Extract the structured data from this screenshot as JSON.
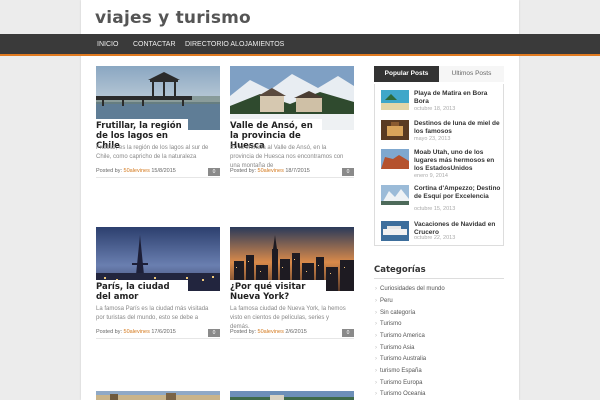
{
  "site": {
    "title": "viajes y turismo"
  },
  "nav": {
    "items": [
      "INICIO",
      "CONTACTAR",
      "DIRECTORIO ALOJAMIENTOS"
    ]
  },
  "posts": [
    {
      "title": "Frutillar, la región de los lagos en Chile",
      "excerpt": "Frutillar, es la región de los lagos al sur de Chile, como capricho de la naturaleza",
      "meta_prefix": "Posted by:",
      "author": "50alevines",
      "date": "15/8/2015",
      "comments": "0"
    },
    {
      "title": "Valle de Ansó, en la provincia de Huesca",
      "excerpt": "En la entrada al Valle de Ansó, en la provincia de Huesca nos encontramos con una montaña de",
      "meta_prefix": "Posted by:",
      "author": "50alevines",
      "date": "18/7/2015",
      "comments": "0"
    },
    {
      "title": "París, la ciudad del amor",
      "excerpt": "La famosa París es la ciudad más visitada por turistas del mundo, esto se debe a",
      "meta_prefix": "Posted by:",
      "author": "50alevines",
      "date": "17/6/2015",
      "comments": "0"
    },
    {
      "title": "¿Por qué visitar Nueva York?",
      "excerpt": "La famosa ciudad de Nueva York, la hemos visto en cientos de películas, series y demás.",
      "meta_prefix": "Posted by:",
      "author": "50alevines",
      "date": "2/6/2015",
      "comments": "0"
    }
  ],
  "sidebar": {
    "tabs": {
      "active": "Popular Posts",
      "inactive": "Ultimos Posts"
    },
    "popular": [
      {
        "title": "Playa de Matira en Bora Bora",
        "date": "octubre 18, 2013"
      },
      {
        "title": "Destinos de luna de miel de los famosos",
        "date": "mayo 23, 2013"
      },
      {
        "title": "Moab Utah, uno de los lugares más hermosos en los EstadosUnidos",
        "date": "enero 9, 2014"
      },
      {
        "title": "Cortina d'Ampezzo; Destino de Esquí por Excelencia",
        "date": "octubre 15, 2013"
      },
      {
        "title": "Vacaciones de Navidad en Crucero",
        "date": "octubre 22, 2013"
      }
    ],
    "categories_heading": "Categorías",
    "categories": [
      "Curiosidades del mundo",
      "Peru",
      "Sin categoría",
      "Turismo",
      "Turismo America",
      "Turismo Asia",
      "Turismo Australia",
      "turismo España",
      "Turismo Europa",
      "Turismo Oceania"
    ]
  },
  "colors": {
    "nav_bg": "#3a3a3a",
    "accent": "#e07a20",
    "author": "#d4791d"
  }
}
